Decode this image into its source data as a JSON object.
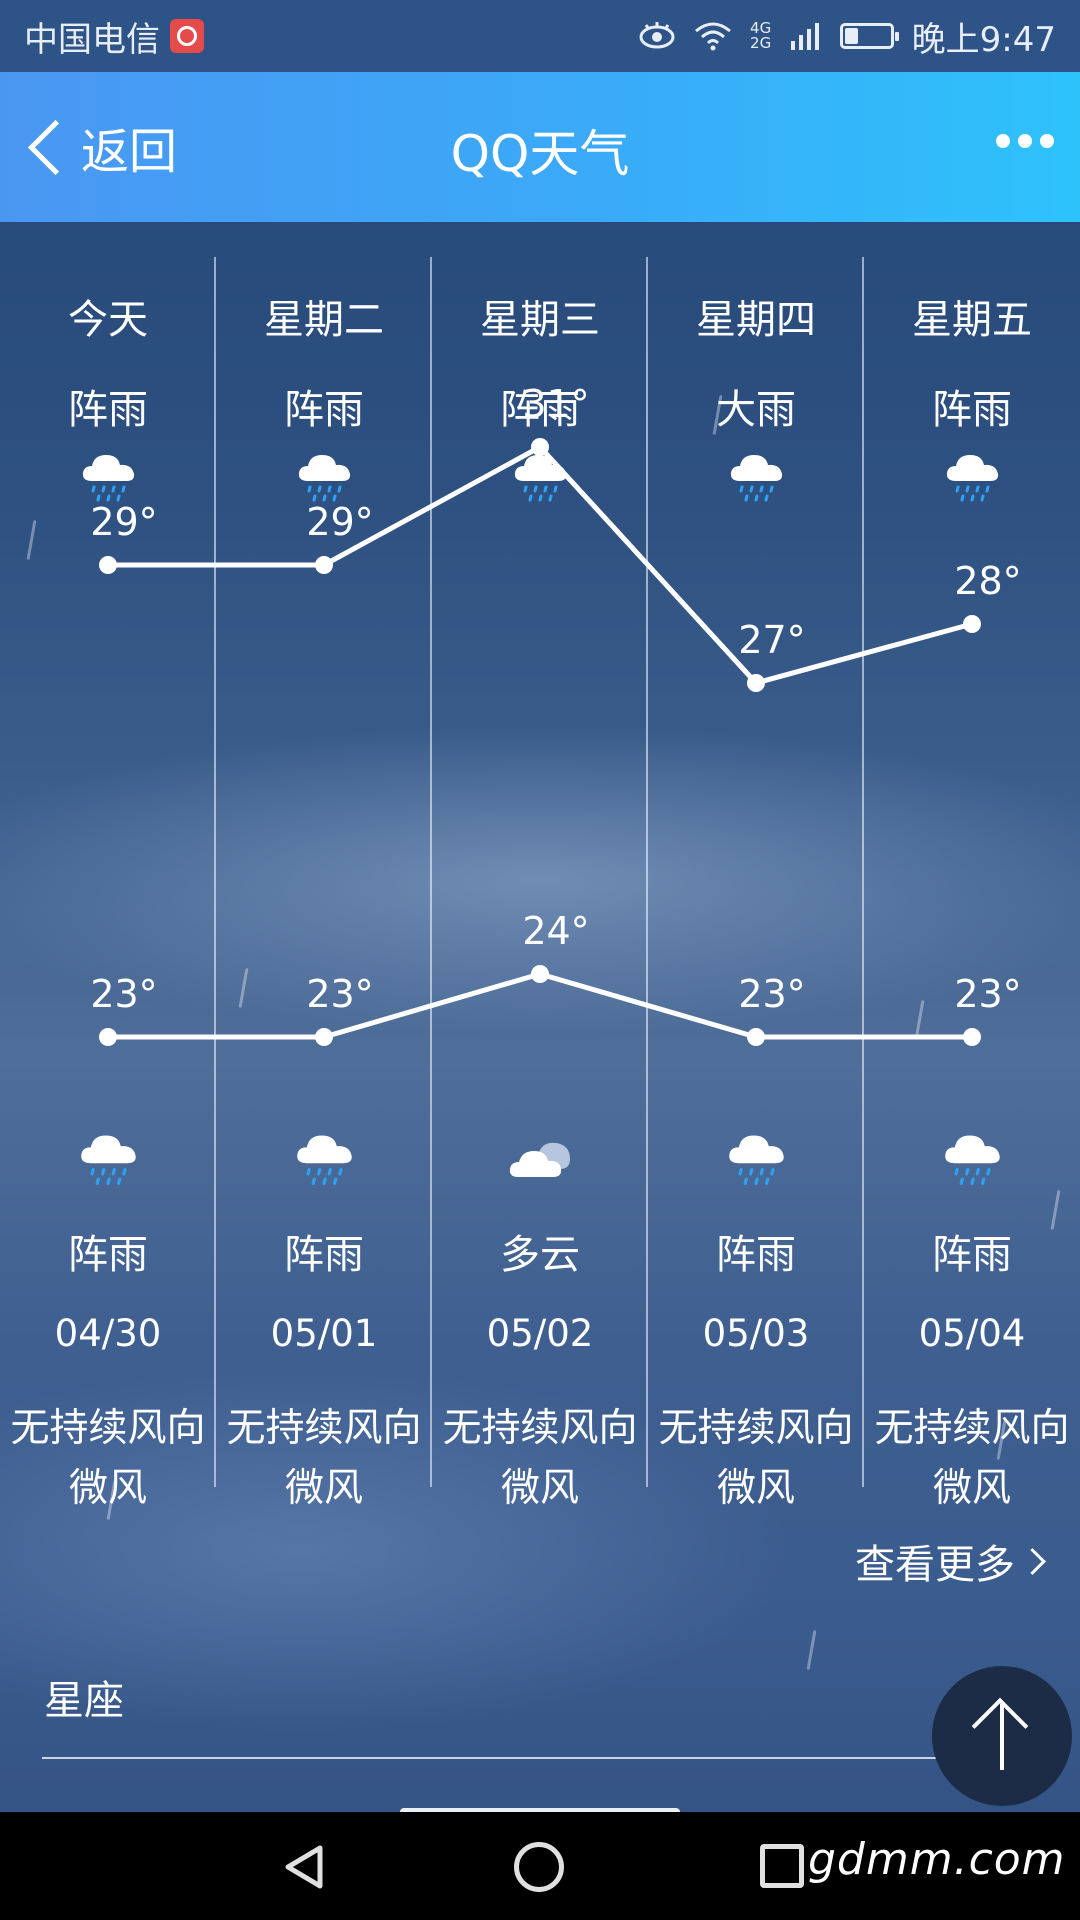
{
  "status_bar": {
    "carrier": "中国电信",
    "network": "4G 2G",
    "time": "晚上9:47",
    "battery_level": 0.3
  },
  "header": {
    "back_label": "返回",
    "title": "QQ天气"
  },
  "forecast": {
    "days": [
      {
        "day": "今天",
        "day_weather": "阵雨",
        "day_icon": "shower-rain-icon",
        "high": "29°",
        "low": "23°",
        "night_icon": "shower-rain-icon",
        "night_weather": "阵雨",
        "date": "04/30",
        "wind_direction": "无持续风向",
        "wind_level": "微风"
      },
      {
        "day": "星期二",
        "day_weather": "阵雨",
        "day_icon": "shower-rain-icon",
        "high": "29°",
        "low": "23°",
        "night_icon": "shower-rain-icon",
        "night_weather": "阵雨",
        "date": "05/01",
        "wind_direction": "无持续风向",
        "wind_level": "微风"
      },
      {
        "day": "星期三",
        "day_weather": "阵雨",
        "day_icon": "shower-rain-icon",
        "high": "31°",
        "low": "24°",
        "night_icon": "cloudy-icon",
        "night_weather": "多云",
        "date": "05/02",
        "wind_direction": "无持续风向",
        "wind_level": "微风"
      },
      {
        "day": "星期四",
        "day_weather": "大雨",
        "day_icon": "heavy-rain-icon",
        "high": "27°",
        "low": "23°",
        "night_icon": "shower-rain-icon",
        "night_weather": "阵雨",
        "date": "05/03",
        "wind_direction": "无持续风向",
        "wind_level": "微风"
      },
      {
        "day": "星期五",
        "day_weather": "阵雨",
        "day_icon": "shower-rain-icon",
        "high": "28°",
        "low": "23°",
        "night_icon": "shower-rain-icon",
        "night_weather": "阵雨",
        "date": "05/04",
        "wind_direction": "无持续风向",
        "wind_level": "微风"
      }
    ]
  },
  "chart_data": {
    "type": "line",
    "categories": [
      "今天",
      "星期二",
      "星期三",
      "星期四",
      "星期五"
    ],
    "series": [
      {
        "values": [
          29,
          29,
          31,
          27,
          28
        ]
      },
      {
        "values": [
          23,
          23,
          24,
          23,
          23
        ]
      }
    ],
    "labels_high": [
      "29°",
      "29°",
      "31°",
      "27°",
      "28°"
    ],
    "labels_low": [
      "23°",
      "23°",
      "24°",
      "23°",
      "23°"
    ]
  },
  "footer": {
    "view_more": "查看更多",
    "constellation": "星座"
  },
  "watermark": "gdmm.com",
  "colors": {
    "titlebar_start": "#4a97f2",
    "titlebar_end": "#2ec2fb",
    "rain_drop": "#2ea1f0"
  }
}
